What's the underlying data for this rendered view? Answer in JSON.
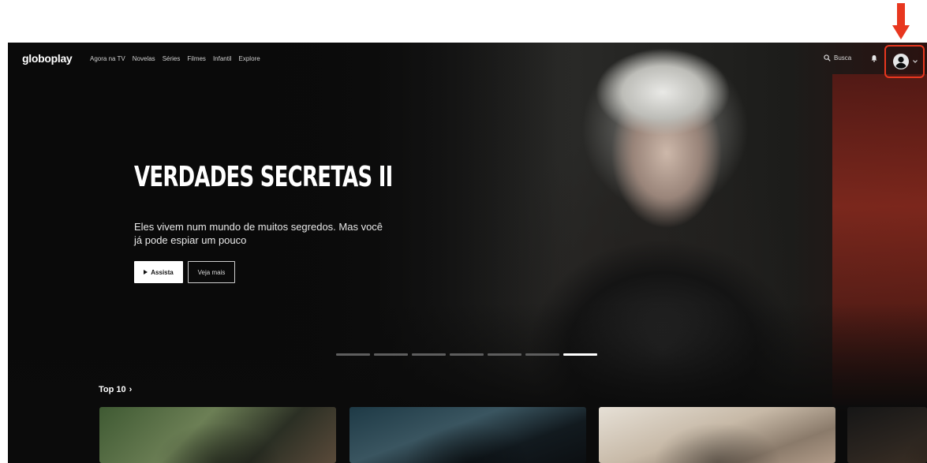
{
  "nav": {
    "logo": "globoplay",
    "links": [
      "Agora na TV",
      "Novelas",
      "Séries",
      "Filmes",
      "Infantil",
      "Explore"
    ],
    "search_label": "Busca"
  },
  "hero": {
    "title": "VERDADES SECRETAS II",
    "description": "Eles vivem num mundo de muitos segredos. Mas você já pode espiar um pouco",
    "watch_label": "Assista",
    "more_label": "Veja mais",
    "slides_total": 7,
    "active_slide": 7
  },
  "rows": [
    {
      "title": "Top 10",
      "arrow": "›"
    }
  ],
  "colors": {
    "background": "#0b0b0b",
    "annotation": "#e8371f",
    "primary_button": "#ffffff"
  },
  "icons": [
    "search-icon",
    "bell-icon",
    "user-avatar-icon",
    "chevron-down-icon",
    "play-icon"
  ]
}
